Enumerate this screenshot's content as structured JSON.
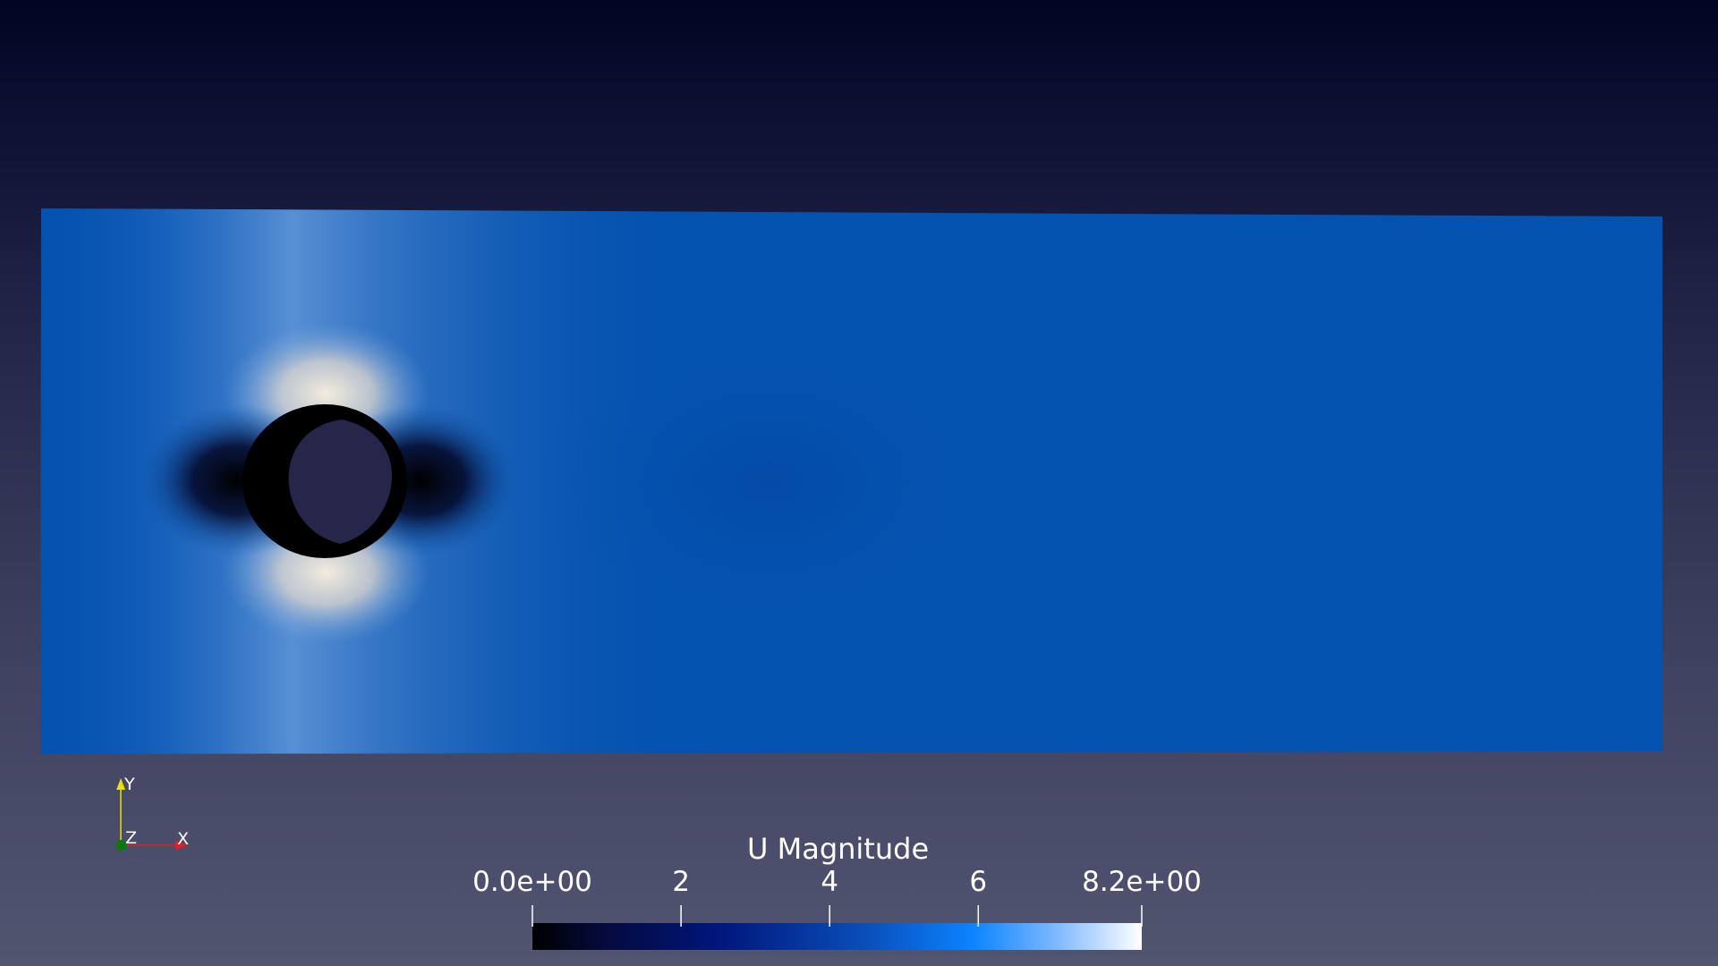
{
  "scene": {
    "background_top": "#020424",
    "background_bottom": "#525570",
    "domain_base_color": "#0452b0",
    "near_wall_color": "#000000",
    "jet_highlight_color": "#f0e8d8",
    "obstacle_interior_color": "#25264a"
  },
  "legend": {
    "title": "U Magnitude",
    "ticks": [
      "0.0e+00",
      "2",
      "4",
      "6",
      "8.2e+00"
    ],
    "tick_values": [
      0.0,
      2,
      4,
      6,
      8.2
    ],
    "range": [
      0.0,
      8.2
    ],
    "colormap": [
      "#000000",
      "#040b3e",
      "#00157a",
      "#0a4fba",
      "#0a83ff",
      "#7fb8ff",
      "#ffffff"
    ]
  },
  "orientation_axes": {
    "x_label": "X",
    "y_label": "Y",
    "z_label": "Z",
    "x_color": "#e02020",
    "y_color": "#e8e000",
    "z_color": "#0b7a0b"
  }
}
